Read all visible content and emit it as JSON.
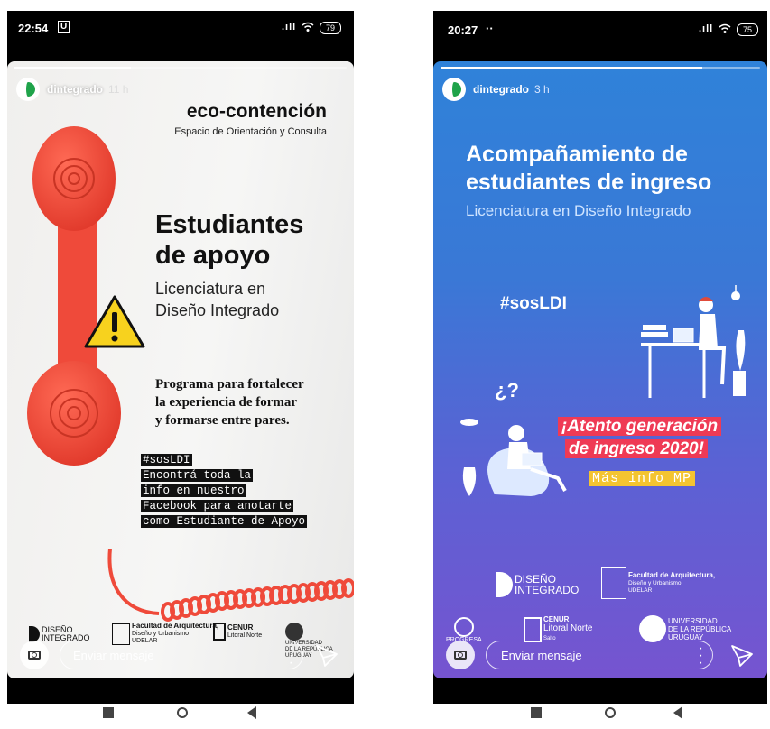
{
  "left": {
    "status": {
      "time": "22:54",
      "extra": "U",
      "signal": ".ıll",
      "battery": "79"
    },
    "story": {
      "progress": 0.35,
      "username": "dintegrado",
      "time": "11 h",
      "eco_title": "eco-contención",
      "eco_subtitle": "Espacio de Orientación y Consulta",
      "headline": [
        "Estudiantes",
        "de apoyo"
      ],
      "sub": [
        "Licenciatura en",
        "Diseño Integrado"
      ],
      "program": [
        "Programa para fortalecer",
        "la experiencia de formar",
        "y formarse entre pares."
      ],
      "mono_lines": [
        "#sosLDI",
        "Encontrá toda la",
        "info en nuestro",
        "Facebook para anotarte",
        "como Estudiante de Apoyo"
      ],
      "logos": {
        "di1": "DISEÑO",
        "di2": "INTEGRADO",
        "fadu1": "Facultad de Arquitectura,",
        "fadu2": "Diseño y Urbanismo",
        "fadu3": "UDELAR",
        "cenur1": "CENUR",
        "cenur2": "Litoral Norte",
        "udelar1": "UNIVERSIDAD",
        "udelar2": "DE LA REPÚBLICA",
        "udelar3": "URUGUAY"
      }
    },
    "reply_placeholder": "Enviar mensaje",
    "icons": [
      "camera-icon",
      "more-vertical-icon",
      "send-icon",
      "warning-icon"
    ]
  },
  "right": {
    "status": {
      "time": "20:27",
      "extra": "··",
      "signal": ".ıll",
      "battery": "75"
    },
    "story": {
      "progress": 0.82,
      "username": "dintegrado",
      "time": "3 h",
      "title": [
        "Acompañamiento de",
        "estudiantes de ingreso"
      ],
      "subtitle": "Licenciatura en Diseño Integrado",
      "hashtag": "#sosLDI",
      "atento": [
        "¡Atento generación",
        "de ingreso 2020!"
      ],
      "mas_info": "Más info MP",
      "logos": {
        "di1": "DISEÑO",
        "di2": "INTEGRADO",
        "fadu1": "Facultad de Arquitectura,",
        "fadu2": "Diseño y Urbanismo",
        "fadu3": "UDELAR",
        "progresa": "PROGRESA",
        "cenur1": "CENUR",
        "cenur2": "Litoral Norte",
        "cenur3": "Salto",
        "udelar1": "UNIVERSIDAD",
        "udelar2": "DE LA REPÚBLICA",
        "udelar3": "URUGUAY"
      }
    },
    "reply_placeholder": "Enviar mensaje"
  },
  "colors": {
    "phone_bg": "#000000",
    "brand_green": "#1fa34a",
    "accent_red": "#ef3a55",
    "accent_yellow": "#f4c430",
    "handset_red": "#ef4a3a"
  }
}
